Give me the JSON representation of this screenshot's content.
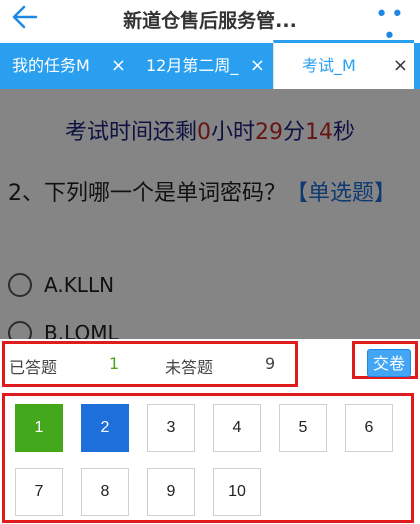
{
  "header": {
    "title": "新道仓售后服务管...",
    "back_icon": "arrow-left-icon",
    "more_icon": "more-dots-icon",
    "more_label": "• • •"
  },
  "tabs": [
    {
      "label": "我的任务M",
      "close": "×",
      "active": false
    },
    {
      "label": "12月第二周_",
      "close": "×",
      "active": false
    },
    {
      "label": "考试_M",
      "close": "×",
      "active": true
    }
  ],
  "timer": {
    "prefix": "考试时间还剩",
    "hours": "0",
    "hours_unit": "小时",
    "minutes": "29",
    "minutes_unit": "分",
    "seconds": "14",
    "seconds_unit": "秒"
  },
  "question": {
    "text": "2、下列哪一个是单词密码？",
    "type": "【单选题】",
    "options": [
      "A.KLLN",
      "B.LOML"
    ]
  },
  "answer_sheet": {
    "answered_label": "已答题",
    "answered_count": "1",
    "unanswered_label": "未答题",
    "unanswered_count": "9",
    "submit_label": "交卷",
    "numbers": [
      "1",
      "2",
      "3",
      "4",
      "5",
      "6",
      "7",
      "8",
      "9",
      "10"
    ],
    "answered_color": "#43a81b",
    "current_color": "#1e6fd9"
  }
}
